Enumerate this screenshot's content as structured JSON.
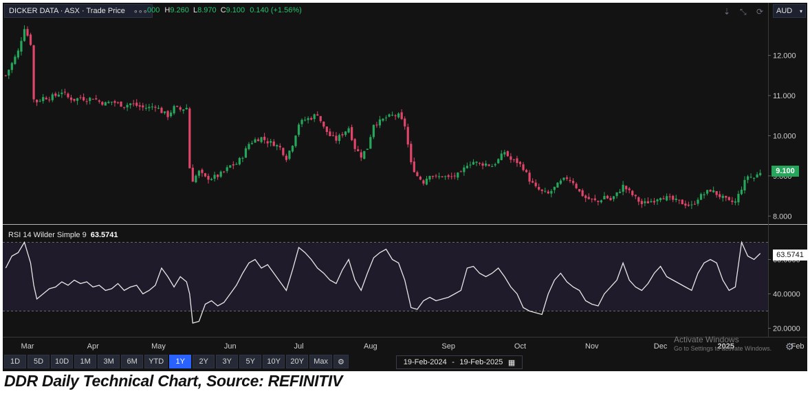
{
  "header": {
    "symbol_label": "DICKER DATA · ASX · Trade Price",
    "dots": "∘∘∘",
    "ohlc_prefix": "000",
    "h_label": "H",
    "h_value": "9.260",
    "l_label": "L",
    "l_value": "8.970",
    "c_label": "C",
    "c_value": "9.100",
    "change": "0.140 (+1.56%)",
    "currency": "AUD"
  },
  "icons": [
    "download-icon",
    "collapse-icon",
    "refresh-icon",
    "chevron-down-icon",
    "settings-icon",
    "calendar-icon"
  ],
  "colors": {
    "up": "#26a65b",
    "down": "#e0456a",
    "background": "#131313",
    "rsi_band": "#1f1b2a",
    "accent": "#2962ff"
  },
  "price_tag": "9.100",
  "rsi_tag": "63.5741",
  "rsi_label": {
    "name": "RSI 14 Wilder Simple 9",
    "value": "63.5741"
  },
  "watermark": {
    "line1": "Activate Windows",
    "line2": "Go to Settings to activate Windows."
  },
  "range_buttons": [
    "1D",
    "5D",
    "10D",
    "1M",
    "3M",
    "6M",
    "YTD",
    "1Y",
    "2Y",
    "3Y",
    "5Y",
    "10Y",
    "20Y",
    "Max"
  ],
  "active_range": "1Y",
  "date_range": {
    "from": "19-Feb-2024",
    "sep": "-",
    "to": "19-Feb-2025"
  },
  "caption": "DDR Daily Technical Chart, Source: REFINITIV",
  "chart_data": [
    {
      "type": "candlestick",
      "title": "DICKER DATA · ASX · Trade Price",
      "currency": "AUD",
      "y_ticks": [
        "12.000",
        "11.000",
        "10.000",
        "9.000",
        "8.000"
      ],
      "ylim": [
        7.8,
        12.9
      ],
      "x_tick_labels": [
        "Mar",
        "Apr",
        "May",
        "Jun",
        "Jul",
        "Aug",
        "Sep",
        "Oct",
        "Nov",
        "Dec",
        "2025",
        "Feb"
      ],
      "x_tick_positions": [
        7,
        28,
        49,
        72,
        94,
        117,
        142,
        165,
        188,
        210,
        231,
        254
      ],
      "close_path": [
        [
          0,
          11.5
        ],
        [
          2,
          11.8
        ],
        [
          4,
          12.1
        ],
        [
          6,
          12.7
        ],
        [
          8,
          12.3
        ],
        [
          9,
          10.9
        ],
        [
          10,
          10.85
        ],
        [
          12,
          10.95
        ],
        [
          14,
          10.95
        ],
        [
          16,
          11.0
        ],
        [
          18,
          11.1
        ],
        [
          20,
          10.95
        ],
        [
          22,
          10.9
        ],
        [
          24,
          10.95
        ],
        [
          26,
          10.9
        ],
        [
          28,
          10.95
        ],
        [
          30,
          10.85
        ],
        [
          32,
          10.8
        ],
        [
          34,
          10.85
        ],
        [
          36,
          10.8
        ],
        [
          38,
          10.75
        ],
        [
          40,
          10.8
        ],
        [
          42,
          10.75
        ],
        [
          44,
          10.7
        ],
        [
          46,
          10.7
        ],
        [
          48,
          10.75
        ],
        [
          50,
          10.6
        ],
        [
          52,
          10.5
        ],
        [
          54,
          10.7
        ],
        [
          56,
          10.65
        ],
        [
          58,
          10.7
        ],
        [
          59,
          9.2
        ],
        [
          60,
          8.9
        ],
        [
          62,
          9.1
        ],
        [
          64,
          8.95
        ],
        [
          66,
          8.95
        ],
        [
          68,
          9.0
        ],
        [
          70,
          9.1
        ],
        [
          72,
          9.25
        ],
        [
          74,
          9.3
        ],
        [
          76,
          9.5
        ],
        [
          78,
          9.8
        ],
        [
          80,
          9.9
        ],
        [
          82,
          9.95
        ],
        [
          84,
          9.85
        ],
        [
          86,
          9.8
        ],
        [
          88,
          9.7
        ],
        [
          90,
          9.45
        ],
        [
          92,
          9.8
        ],
        [
          94,
          10.3
        ],
        [
          96,
          10.4
        ],
        [
          98,
          10.45
        ],
        [
          100,
          10.55
        ],
        [
          102,
          10.2
        ],
        [
          104,
          10.0
        ],
        [
          106,
          9.9
        ],
        [
          108,
          10.05
        ],
        [
          110,
          10.2
        ],
        [
          112,
          9.7
        ],
        [
          114,
          9.5
        ],
        [
          116,
          9.7
        ],
        [
          118,
          10.3
        ],
        [
          120,
          10.35
        ],
        [
          122,
          10.45
        ],
        [
          124,
          10.5
        ],
        [
          126,
          10.5
        ],
        [
          128,
          10.25
        ],
        [
          130,
          9.3
        ],
        [
          132,
          9.0
        ],
        [
          134,
          8.85
        ],
        [
          136,
          9.05
        ],
        [
          138,
          8.95
        ],
        [
          140,
          9.0
        ],
        [
          142,
          8.95
        ],
        [
          144,
          9.0
        ],
        [
          146,
          9.05
        ],
        [
          148,
          9.3
        ],
        [
          150,
          9.35
        ],
        [
          152,
          9.3
        ],
        [
          154,
          9.3
        ],
        [
          156,
          9.25
        ],
        [
          158,
          9.4
        ],
        [
          160,
          9.6
        ],
        [
          162,
          9.4
        ],
        [
          164,
          9.35
        ],
        [
          166,
          9.2
        ],
        [
          168,
          8.9
        ],
        [
          170,
          8.7
        ],
        [
          172,
          8.6
        ],
        [
          174,
          8.55
        ],
        [
          176,
          8.7
        ],
        [
          178,
          8.85
        ],
        [
          180,
          8.95
        ],
        [
          182,
          8.85
        ],
        [
          184,
          8.6
        ],
        [
          186,
          8.45
        ],
        [
          188,
          8.4
        ],
        [
          190,
          8.35
        ],
        [
          192,
          8.5
        ],
        [
          194,
          8.4
        ],
        [
          196,
          8.55
        ],
        [
          198,
          8.75
        ],
        [
          200,
          8.6
        ],
        [
          202,
          8.45
        ],
        [
          204,
          8.3
        ],
        [
          206,
          8.35
        ],
        [
          208,
          8.4
        ],
        [
          210,
          8.5
        ],
        [
          212,
          8.45
        ],
        [
          214,
          8.4
        ],
        [
          216,
          8.35
        ],
        [
          218,
          8.3
        ],
        [
          220,
          8.25
        ],
        [
          222,
          8.45
        ],
        [
          224,
          8.55
        ],
        [
          226,
          8.65
        ],
        [
          228,
          8.55
        ],
        [
          230,
          8.45
        ],
        [
          232,
          8.35
        ],
        [
          234,
          8.35
        ],
        [
          236,
          8.7
        ],
        [
          238,
          9.0
        ],
        [
          240,
          8.95
        ],
        [
          242,
          9.1
        ]
      ]
    },
    {
      "type": "line",
      "title": "RSI 14 Wilder Simple 9",
      "y_ticks": [
        "60.0000",
        "40.0000",
        "20.0000"
      ],
      "ylim": [
        15,
        75
      ],
      "bands": [
        70,
        30
      ],
      "x": [
        0,
        2,
        4,
        6,
        8,
        9,
        10,
        12,
        14,
        16,
        18,
        20,
        22,
        24,
        26,
        28,
        30,
        32,
        34,
        36,
        38,
        40,
        42,
        44,
        46,
        48,
        50,
        52,
        54,
        56,
        58,
        59,
        60,
        62,
        64,
        66,
        68,
        70,
        72,
        74,
        76,
        78,
        80,
        82,
        84,
        86,
        88,
        90,
        92,
        94,
        96,
        98,
        100,
        102,
        104,
        106,
        108,
        110,
        112,
        114,
        116,
        118,
        120,
        122,
        124,
        126,
        128,
        130,
        132,
        134,
        136,
        138,
        140,
        142,
        144,
        146,
        148,
        150,
        152,
        154,
        156,
        158,
        160,
        162,
        164,
        166,
        168,
        170,
        172,
        174,
        176,
        178,
        180,
        182,
        184,
        186,
        188,
        190,
        192,
        194,
        196,
        198,
        200,
        202,
        204,
        206,
        208,
        210,
        212,
        214,
        216,
        218,
        220,
        222,
        224,
        226,
        228,
        230,
        232,
        234,
        236,
        238,
        240,
        242
      ],
      "values": [
        55,
        62,
        64,
        70,
        58,
        45,
        37,
        40,
        43,
        44,
        47,
        45,
        48,
        46,
        47,
        44,
        45,
        42,
        43,
        46,
        42,
        44,
        45,
        40,
        42,
        45,
        55,
        50,
        44,
        50,
        47,
        40,
        23,
        24,
        34,
        36,
        33,
        35,
        40,
        45,
        52,
        58,
        60,
        55,
        57,
        52,
        47,
        42,
        54,
        67,
        64,
        60,
        55,
        52,
        48,
        46,
        54,
        60,
        48,
        42,
        52,
        61,
        64,
        66,
        60,
        58,
        48,
        32,
        31,
        36,
        38,
        36,
        37,
        38,
        40,
        42,
        55,
        56,
        52,
        50,
        52,
        55,
        50,
        44,
        40,
        32,
        30,
        29,
        28,
        40,
        48,
        52,
        47,
        44,
        42,
        36,
        34,
        33,
        40,
        44,
        48,
        58,
        48,
        44,
        42,
        46,
        52,
        56,
        50,
        48,
        46,
        44,
        42,
        52,
        58,
        60,
        58,
        48,
        42,
        44,
        70,
        62,
        60,
        63.57
      ]
    }
  ]
}
